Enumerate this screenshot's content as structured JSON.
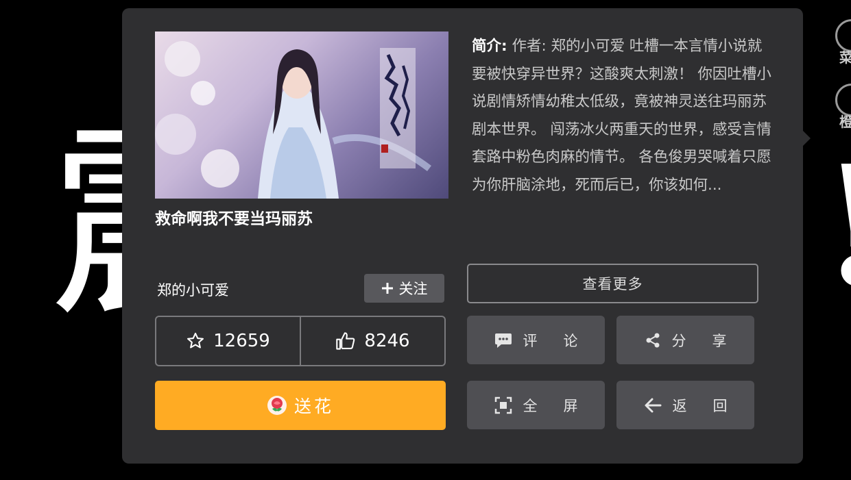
{
  "background": {
    "left_glyph": "震",
    "right_glyph": "!"
  },
  "side_menu": {
    "item1_label": "菜",
    "item2_label": "橙"
  },
  "book": {
    "title": "救命啊我不要当玛丽苏",
    "author": "郑的小可爱",
    "follow_label": "关注",
    "intro_label": "简介:",
    "intro_text": "作者: 郑的小可爱 吐槽一本言情小说就要被快穿异世界？这酸爽太刺激！ 你因吐槽小说剧情矫情幼稚太低级，竟被神灵送往玛丽苏剧本世界。 闯荡冰火两重天的世界，感受言情套路中粉色肉麻的情节。 各色俊男哭喊着只愿为你肝脑涂地，死而后已，你该如何...",
    "favorites": "12659",
    "likes": "8246"
  },
  "buttons": {
    "send_flower": "送花",
    "view_more": "查看更多",
    "comment": "评论",
    "share": "分享",
    "fullscreen": "全屏",
    "back": "返回"
  },
  "colors": {
    "panel": "#2f2f31",
    "accent": "#ffab23",
    "button": "#4f4f53"
  },
  "icons": [
    "star-icon",
    "thumbs-up-icon",
    "flower-icon",
    "plus-icon",
    "comment-icon",
    "share-icon",
    "fullscreen-icon",
    "back-arrow-icon"
  ]
}
